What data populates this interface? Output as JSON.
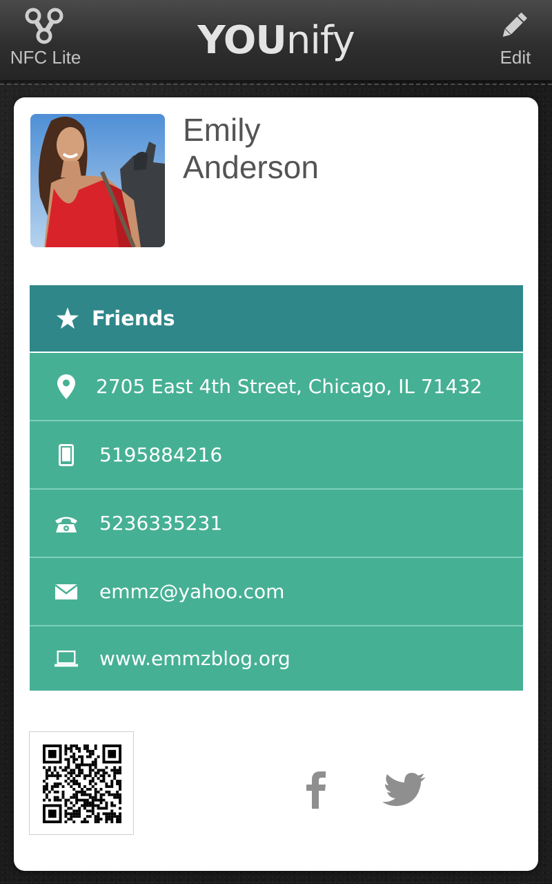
{
  "header": {
    "left_button_label": "NFC Lite",
    "title_bold": "YOU",
    "title_rest": "nify",
    "right_button_label": "Edit"
  },
  "profile": {
    "first_name": "Emily",
    "last_name": "Anderson"
  },
  "group": {
    "label": "Friends",
    "icon": "star-icon"
  },
  "contact_rows": [
    {
      "icon": "location-pin-icon",
      "value": "2705 East 4th Street, Chicago, IL 71432"
    },
    {
      "icon": "mobile-phone-icon",
      "value": "5195884216"
    },
    {
      "icon": "telephone-icon",
      "value": "5236335231"
    },
    {
      "icon": "envelope-icon",
      "value": "emmz@yahoo.com"
    },
    {
      "icon": "laptop-icon",
      "value": "www.emmzblog.org"
    }
  ],
  "social": [
    "facebook-icon",
    "twitter-icon"
  ],
  "colors": {
    "group_header": "#2f878a",
    "row_background": "#46b094",
    "row_divider": "#7fd0bb",
    "name_text": "#545454",
    "header_text": "#c4c4c4"
  }
}
